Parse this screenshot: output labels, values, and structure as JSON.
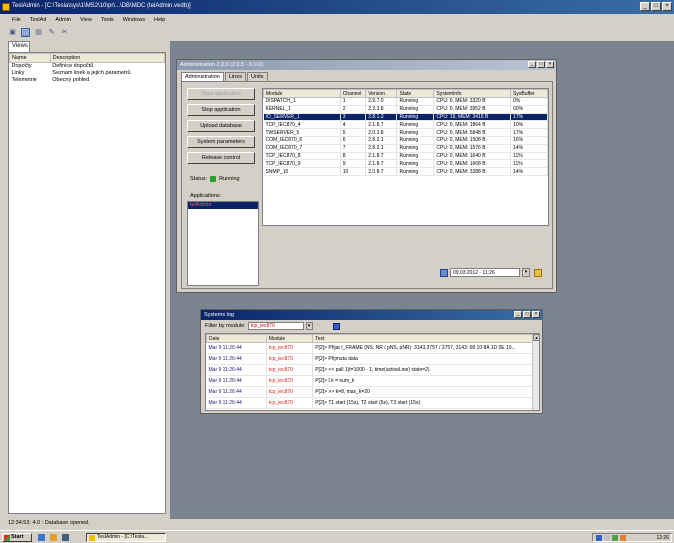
{
  "app": {
    "title": "TeslAdmin - [C:\\Tesla\\sys\\1\\MS2\\10\\pr\\...\\DB\\MDC (telAdmin.vedb)]",
    "window_buttons": [
      "_",
      "□",
      "×"
    ]
  },
  "menu": [
    "File",
    "TeslAd",
    "Admin",
    "View",
    "Tools",
    "Windows",
    "Help"
  ],
  "toolbar": {
    "icons": [
      "open-icon",
      "window-icon",
      "list-icon",
      "edit-icon",
      "cut-icon"
    ],
    "glyphs": [
      "▣",
      "◫",
      "▤",
      "✎",
      "✂"
    ]
  },
  "views": {
    "tab_label": "Views",
    "columns": [
      "Name",
      "Description"
    ],
    "rows": [
      {
        "name": "Dopočty",
        "desc": "Definice dopočtů"
      },
      {
        "name": "Linky",
        "desc": "Seznam linek a jejich parametrů"
      },
      {
        "name": "Telemetrie",
        "desc": "Obecný pohled"
      }
    ]
  },
  "admin_window": {
    "title": "Administration 2.0.0 (2.0.5 - 6.0.0)",
    "tabs": [
      "Administration",
      "Lines",
      "Units"
    ],
    "buttons": [
      "Start application",
      "Stop application",
      "Upload database",
      "System parameters",
      "Release control"
    ],
    "status_label": "Status:",
    "status_value": "Running",
    "applications_label": "Applications:",
    "applications_selected": "telAdmin",
    "services": {
      "columns": [
        "Module",
        "Channel",
        "Version",
        "State",
        "SystemInfo",
        "SysBuffer"
      ],
      "rows": [
        [
          "DISPATCH_1",
          "1",
          "2.9.7.0",
          "Running",
          "CPU: 0, MEM: 3320 B",
          "0%"
        ],
        [
          "KERNEL_1",
          "2",
          "2.3.3.8",
          "Running",
          "CPU: 0, MEM: 3952 B",
          "60%"
        ],
        [
          "IO_SERVER_1",
          "3",
          "2.8.1.3",
          "Running",
          "CPU: 19, MEM: 3416 B",
          "17%"
        ],
        [
          "TCP_IEC870_4",
          "4",
          "2.1.8.7",
          "Running",
          "CPU: 0, MEM: 1864 B",
          "10%"
        ],
        [
          "TWSERVER_5",
          "5",
          "2.0.3.8",
          "Running",
          "CPU: 0, MEM: 5848 B",
          "17%"
        ],
        [
          "COM_IEC870_6",
          "6",
          "2.8.2.1",
          "Running",
          "CPU: 0, MEM: 1508 B",
          "16%"
        ],
        [
          "COM_IEC870_7",
          "7",
          "2.8.2.1",
          "Running",
          "CPU: 0, MEM: 1576 B",
          "14%"
        ],
        [
          "TCP_IEC870_8",
          "8",
          "2.1.8.7",
          "Running",
          "CPU: 0, MEM: 1640 B",
          "11%"
        ],
        [
          "TCP_IEC870_9",
          "9",
          "2.1.8.7",
          "Running",
          "CPU: 0, MEM: 1668 B",
          "11%"
        ],
        [
          "SNMP_10",
          "10",
          "2.0.8.7",
          "Running",
          "CPU: 0, MEM: 3288 B",
          "14%"
        ]
      ],
      "selected_row": 2
    },
    "datetime": "09.03.2012 - 11:26"
  },
  "log_window": {
    "title": "Systems log",
    "filter_label": "Filter by module:",
    "filter_value": "tcp_iec870",
    "columns": [
      "Date",
      "Module",
      "Text"
    ],
    "rows": [
      [
        "Mar 9 11:26:44",
        "tcp_iec870",
        "P[2]> Přijat I_FRAME (NS: NR / pNS, pNR): 3143,3757 / 3757, 3143: 68 10 8A 1D 0E 10..."
      ],
      [
        "Mar 9 11:26:44",
        "tcp_iec870",
        "P[2]> Přijmuta data"
      ],
      [
        "Mar 9 11:26:44",
        "tcp_iec870",
        "P[2]> << pall 1(t=1000 - 1, time(activeLine) state=2)"
      ],
      [
        "Mar 9 11:26:44",
        "tcp_iec870",
        "P[2]> I.k = num_k"
      ],
      [
        "Mar 9 11:26:44",
        "tcp_iec870",
        "P[2]> >> k=8, max_k=20"
      ],
      [
        "Mar 9 11:26:44",
        "tcp_iec870",
        "P[2]> T1 start (15s), T2 start (5s), T3 start (15s)"
      ]
    ]
  },
  "statusbar": {
    "text": "12:34:53: 4.0 : Database opened."
  },
  "taskbar": {
    "start": "Start",
    "task": "TeslAdmin - [C:\\Tesla...",
    "clock": "12:26"
  },
  "colors": {
    "titlebar": "#0a246a",
    "mdi_bg": "#7b8591",
    "selection": "#0a246a",
    "module_red": "#e02020"
  }
}
